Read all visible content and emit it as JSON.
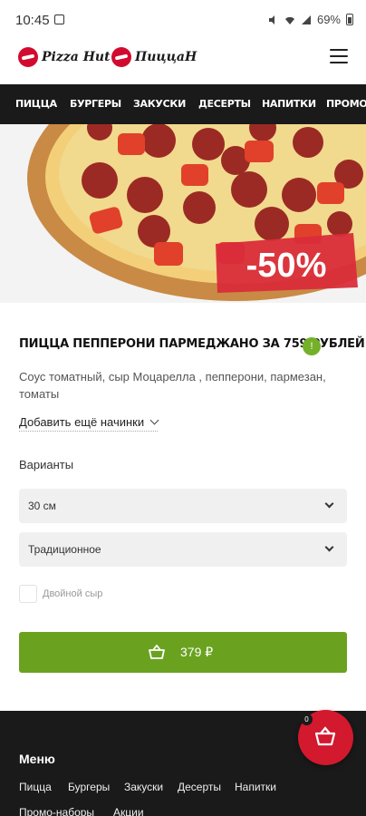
{
  "status_bar": {
    "time": "10:45",
    "battery": "69%"
  },
  "header": {
    "logo_primary": "Pizza Hut",
    "logo_secondary": "ПиццаН"
  },
  "nav": {
    "items": [
      "ПИЦЦА",
      "БУРГЕРЫ",
      "ЗАКУСКИ",
      "ДЕСЕРТЫ",
      "НАПИТКИ",
      "ПРОМО-НА"
    ]
  },
  "hero": {
    "discount": "-50%"
  },
  "product": {
    "title": "ПИЦЦА ПЕППЕРОНИ ПАРМЕДЖАНО ЗА 759 РУБЛЕЙ",
    "badge": "!",
    "description": "Соус томатный, сыр Моцарелла , пепперони, пармезан, томаты",
    "add_toppings": "Добавить ещё начинки",
    "variants_label": "Варианты",
    "size_select": "30 см",
    "dough_select": "Традиционное",
    "double_cheese": "Двойной сыр",
    "price": "379 ₽"
  },
  "footer": {
    "menu_title": "Меню",
    "links_row1": [
      "Пицца",
      "Бургеры",
      "Закуски",
      "Десерты",
      "Напитки"
    ],
    "links_row2": [
      "Промо-наборы",
      "Акции"
    ]
  },
  "cart": {
    "count": "0"
  },
  "colors": {
    "brand_red": "#d20a2e",
    "green": "#6aa220",
    "dark": "#1a1a1a"
  }
}
